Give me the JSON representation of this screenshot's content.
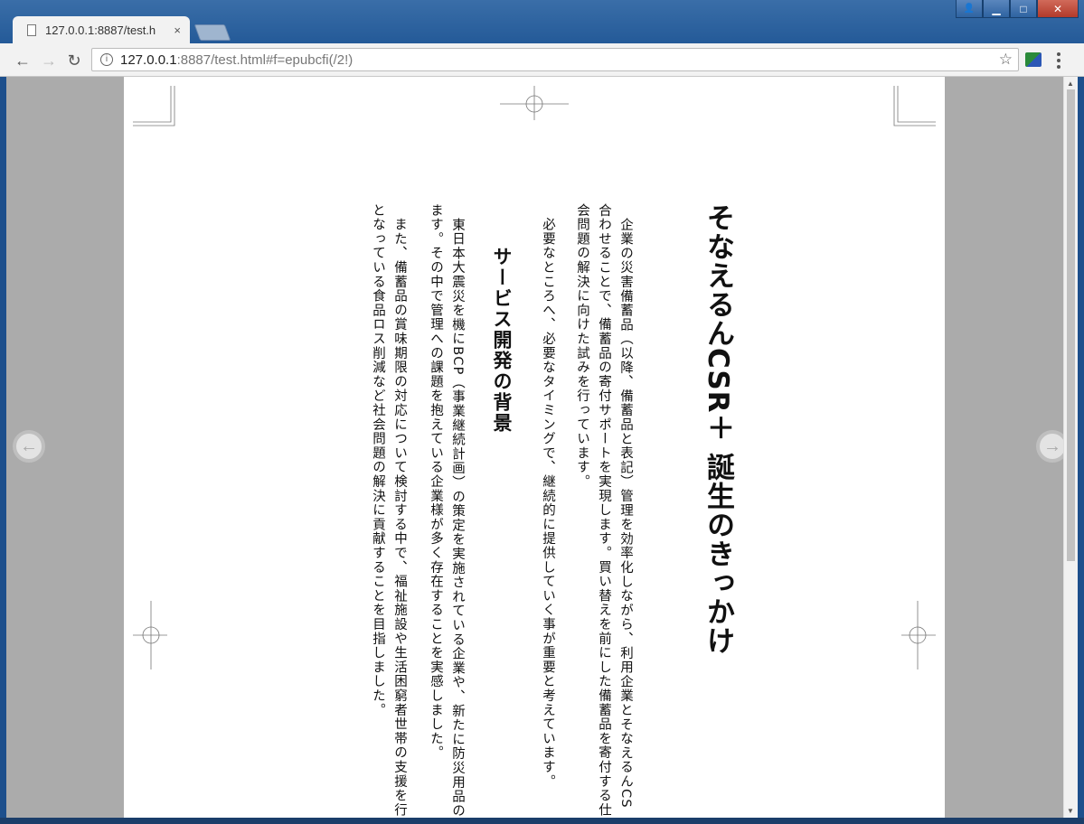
{
  "browser": {
    "tab_title": "127.0.0.1:8887/test.h",
    "tab_close": "×",
    "url_host": "127.0.0.1",
    "url_rest": ":8887/test.html#f=epubcfi(/2!)",
    "info_icon": "i",
    "star_icon": "☆",
    "back_icon": "←",
    "forward_icon": "→",
    "reload_icon": "↻",
    "minimize_icon": "▁",
    "maximize_icon": "□",
    "close_icon": "✕",
    "user_icon": "👤"
  },
  "reader": {
    "title": "そなえるんCSR＋ 誕生のきっかけ",
    "paragraphs": [
      "企業の災害備蓄品（以降、備蓄品と表記）管理を効率化しながら、利用企業とそなえるんCS",
      "合わせることで、備蓄品の寄付サポートを実現します。買い替えを前にした備蓄品を寄付する仕",
      "会問題の解決に向けた試みを行っています。"
    ],
    "paragraph2": "　必要なところへ、必要なタイミングで、継続的に提供していく事が重要と考えています。",
    "heading": "サービス開発の背景",
    "paragraphs3": [
      "東日本大震災を機にBCP（事業継続計画）の策定を実施されている企業や、新たに防災用品の",
      "ます。その中で管理への課題を抱えている企業様が多く存在することを実感しました。",
      "　また、備蓄品の賞味期限の対応について検討する中で、福祉施設や生活困窮者世帯の支援を行",
      "となっている食品ロス削減など社会問題の解決に貢献することを目指しました。"
    ],
    "prev_icon": "←",
    "next_icon": "→"
  }
}
